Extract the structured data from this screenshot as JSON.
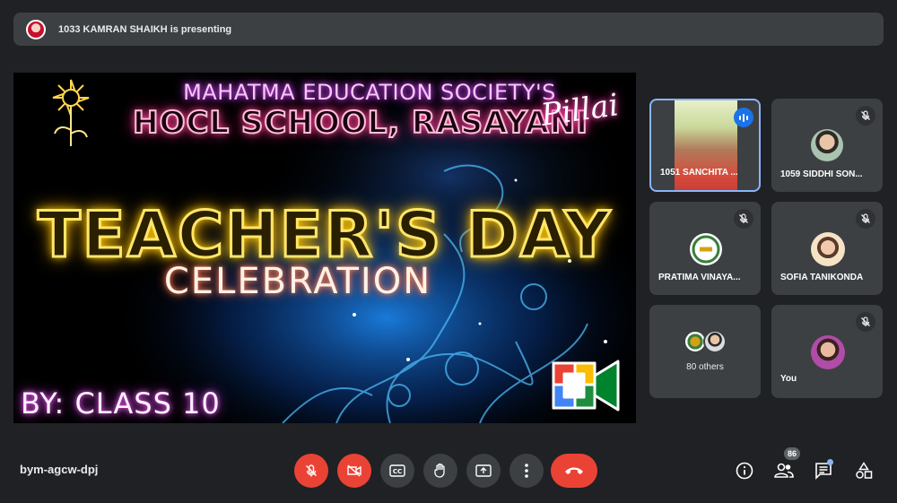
{
  "banner": {
    "text": "1033 KAMRAN SHAIKH is presenting",
    "avatar_icon": "presenter-avatar"
  },
  "slide": {
    "line1": "MAHATMA EDUCATION SOCIETY'S",
    "line2": "HOCL SCHOOL, RASAYANI",
    "signature": "Pillai",
    "title": "TEACHER'S DAY",
    "subtitle": "CELEBRATION",
    "byline": "BY: CLASS 10"
  },
  "participants": [
    {
      "name": "1051 SANCHITA ...",
      "state": "speaking"
    },
    {
      "name": "1059 SIDDHI SON...",
      "state": "muted"
    },
    {
      "name": "PRATIMA VINAYA...",
      "state": "muted"
    },
    {
      "name": "SOFIA TANIKONDA",
      "state": "muted"
    },
    {
      "name": "80 others",
      "state": "group"
    },
    {
      "name": "You",
      "state": "muted"
    }
  ],
  "bottom": {
    "meeting_code": "bym-agcw-dpj",
    "people_count": "86"
  },
  "colors": {
    "background": "#202124",
    "tile": "#3c4043",
    "danger": "#ea4335",
    "active_border": "#8ab4f8",
    "speaking": "#1a73e8"
  }
}
